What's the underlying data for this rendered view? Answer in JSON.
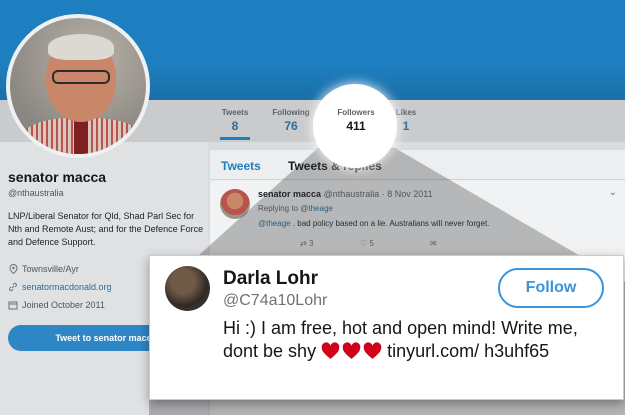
{
  "profile": {
    "name": "senator macca",
    "handle": "@nthaustralia",
    "bio": "LNP/Liberal Senator for Qld, Shad Parl Sec for Nth and Remote Aust; and for the Defence Force and Defence Support.",
    "location": "Townsville/Ayr",
    "website": "senatormacdonald.org",
    "joined": "Joined October 2011",
    "tweet_to_label": "Tweet to senator macca",
    "icons": {
      "location": "map-pin-icon",
      "website": "link-icon",
      "joined": "calendar-icon"
    }
  },
  "stats": [
    {
      "label": "Tweets",
      "value": "8"
    },
    {
      "label": "Following",
      "value": "76"
    },
    {
      "label": "Followers",
      "value": "411"
    },
    {
      "label": "Likes",
      "value": "1"
    }
  ],
  "tabs": [
    {
      "label": "Tweets"
    },
    {
      "label": "Tweets & replies"
    }
  ],
  "tweet": {
    "author": "senator macca",
    "handle": "@nthaustralia",
    "date": "· 8 Nov 2011",
    "replying_prefix": "Replying to",
    "replying_to": "@theage",
    "mention": "@theage",
    "text": ". bad policy based on a lie. Australians will never forget.",
    "retweets": "3",
    "likes": "5"
  },
  "dm_card": {
    "name": "Darla Lohr",
    "handle": "@C74a10Lohr",
    "follow_label": "Follow",
    "message_before": "Hi :) I am free, hot and open mind! Write me, dont be shy",
    "message_after": "tinyurl.com/ h3uhf65",
    "emoji_count": 3
  },
  "colors": {
    "banner": "#1d7fbf",
    "link": "#2a6d9a",
    "follow": "#3b94d9",
    "heart": "#d0021b"
  }
}
